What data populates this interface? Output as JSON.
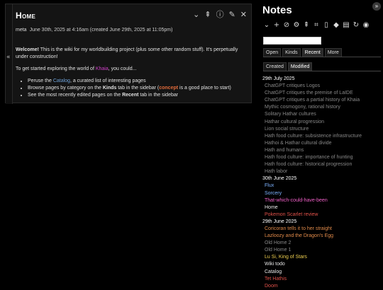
{
  "tiddler": {
    "title": "Home",
    "tools": [
      {
        "name": "more-icon",
        "glyph": "⌄"
      },
      {
        "name": "export-icon",
        "glyph": "⇞"
      },
      {
        "name": "info-icon",
        "glyph": "ⓘ"
      },
      {
        "name": "edit-icon",
        "glyph": "✎"
      },
      {
        "name": "close-icon",
        "glyph": "✕"
      }
    ],
    "modifier": "meta",
    "date": "June 30th, 2025 at 4:16am (created June 29th, 2025 at 11:05pm)",
    "welcome_bold": "Welcome!",
    "welcome_rest": " This is the wiki for my worldbuilding project (plus some other random stuff). It's perpetually under construction!",
    "intro_pre": "To get started exploring the world of ",
    "intro_link": "Khaia",
    "intro_post": ", you could...",
    "bullets": [
      {
        "pre": "Peruse the ",
        "link": "Catalog",
        "post": ", a curated list of interesting pages"
      },
      {
        "pre": "Browse pages by category on the ",
        "bold": "Kinds",
        "mid": " tab in the sidebar (",
        "link": "concept",
        "post": " is a good place to start)"
      },
      {
        "pre": "See the most recently edited pages on the ",
        "bold": "Recent",
        "post": " tab in the sidebar"
      }
    ]
  },
  "sidebar": {
    "title": "Notes",
    "fullscreen_icon": "»",
    "tools": [
      {
        "name": "more-icon",
        "glyph": "⌄"
      },
      {
        "name": "new-tiddler-icon",
        "glyph": "+"
      },
      {
        "name": "attachment-icon",
        "glyph": "⊘"
      },
      {
        "name": "control-panel-icon",
        "glyph": "⚙"
      },
      {
        "name": "export-icon",
        "glyph": "⇞"
      },
      {
        "name": "fullscreen-icon",
        "glyph": "⌗"
      },
      {
        "name": "new-journal-icon",
        "glyph": "▯"
      },
      {
        "name": "tag-icon",
        "glyph": "◆"
      },
      {
        "name": "layout-icon",
        "glyph": "▤"
      },
      {
        "name": "refresh-icon",
        "glyph": "↻"
      },
      {
        "name": "theme-icon",
        "glyph": "◉"
      }
    ],
    "search_placeholder": "",
    "tabs": [
      "Open",
      "Kinds",
      "Recent",
      "More"
    ],
    "active_tab": "Recent",
    "subtabs": [
      "Created",
      "Modified"
    ],
    "active_subtab": "Modified",
    "recent": [
      {
        "day": "29th July 2025",
        "items": [
          {
            "text": "ChatGPT critiques Logos",
            "color": "gray"
          },
          {
            "text": "ChatGPT critiques the premise of LaIDE",
            "color": "gray"
          },
          {
            "text": "ChatGPT critiques a partial history of Khaia",
            "color": "gray"
          },
          {
            "text": "Mythic cosmogony, rational history",
            "color": "gray"
          },
          {
            "text": "Solitary Hathar cultures",
            "color": "gray"
          },
          {
            "text": "Hathar cultural progression",
            "color": "gray"
          },
          {
            "text": "Lion social structure",
            "color": "gray"
          },
          {
            "text": "Hath food culture: subsistence infrastructure",
            "color": "gray"
          },
          {
            "text": "Hathoi & Hathar cultural divide",
            "color": "gray"
          },
          {
            "text": "Hath and humans",
            "color": "gray"
          },
          {
            "text": "Hath food culture: importance of hunting",
            "color": "gray"
          },
          {
            "text": "Hath food culture: historical progression",
            "color": "gray"
          },
          {
            "text": "Hath labor",
            "color": "gray"
          }
        ]
      },
      {
        "day": "30th June 2025",
        "items": [
          {
            "text": "Flux",
            "color": "blue"
          },
          {
            "text": "Sorcery",
            "color": "blue"
          },
          {
            "text": "That-which-could-have-been",
            "color": "pink"
          },
          {
            "text": "Home",
            "color": "white"
          },
          {
            "text": "Pokemon Scarlet review",
            "color": "red"
          }
        ]
      },
      {
        "day": "29th June 2025",
        "items": [
          {
            "text": "Coricoran tells it to her straight",
            "color": "orange"
          },
          {
            "text": "Lazloozy and the Dragon's Egg",
            "color": "orange"
          },
          {
            "text": "Old Home 2",
            "color": "gray"
          },
          {
            "text": "Old Home 1",
            "color": "gray"
          },
          {
            "text": "Lu Si, King of Stars",
            "color": "yellow"
          },
          {
            "text": "Wiki todo",
            "color": "white"
          },
          {
            "text": "Catalog",
            "color": "white"
          },
          {
            "text": "Tet Hathis",
            "color": "red"
          },
          {
            "text": "Doom",
            "color": "red"
          }
        ]
      }
    ]
  }
}
